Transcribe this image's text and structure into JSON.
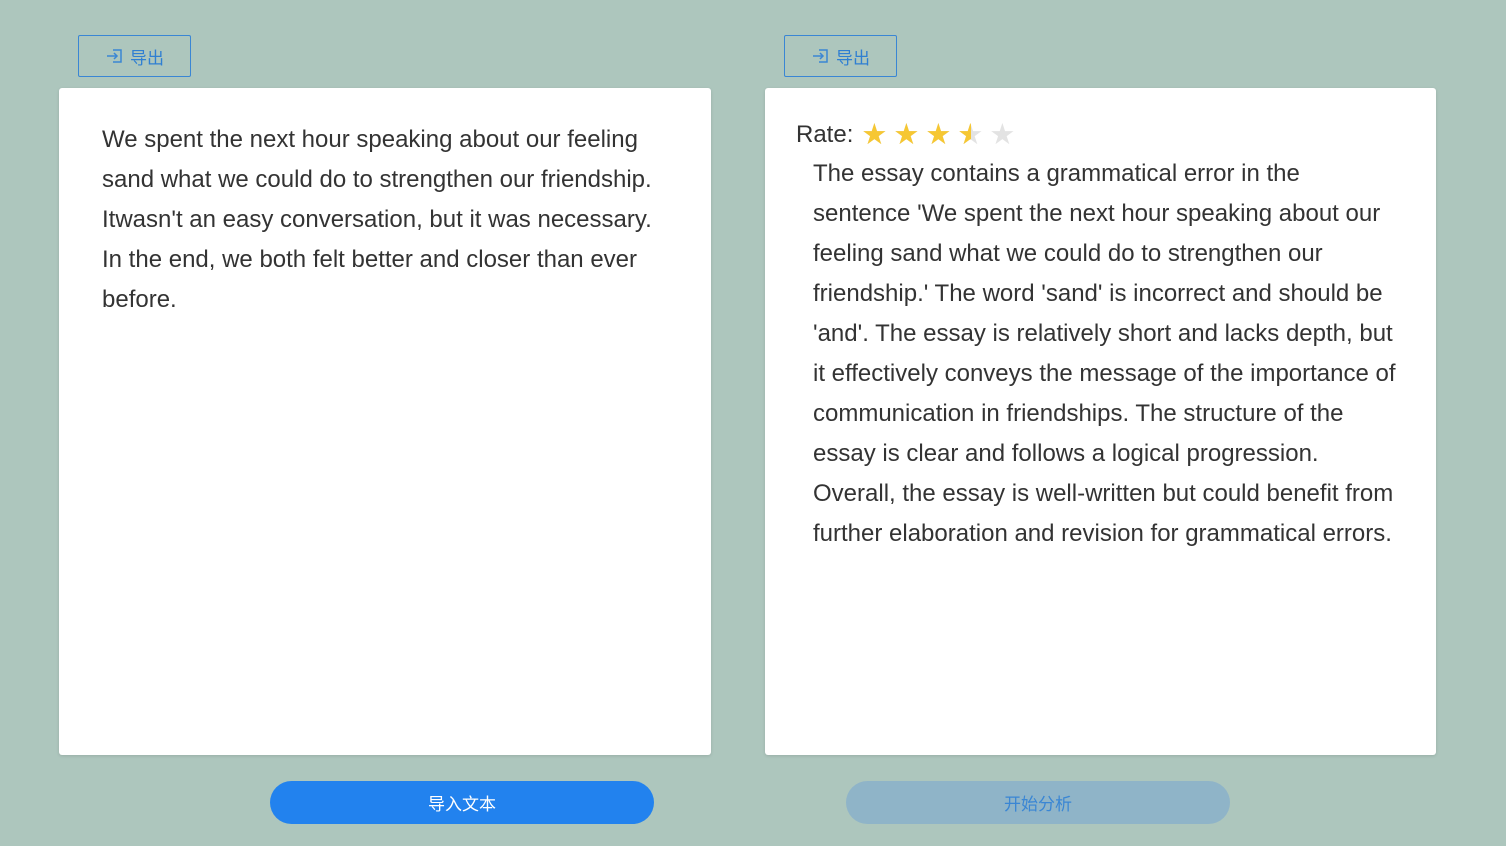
{
  "toolbar": {
    "export_left_label": "导出",
    "export_right_label": "导出"
  },
  "left_panel": {
    "essay": "We spent the next hour speaking about our feeling sand what we could do to strengthen our friendship. Itwasn't an easy conversation, but it was necessary. In the end, we both felt better and closer than ever before."
  },
  "right_panel": {
    "rate_label": "Rate:",
    "rating": 3.5,
    "rating_max": 5,
    "analysis": "The essay contains a grammatical error in the sentence 'We spent the next hour speaking about our feeling sand what we could do to strengthen our friendship.' The word 'sand' is incorrect and should be 'and'. The essay is relatively short and lacks depth, but it effectively conveys the message of the importance of communication in friendships. The structure of the essay is clear and follows a logical progression. Overall, the essay is well-written but could benefit from further elaboration and revision for grammatical errors."
  },
  "actions": {
    "import_label": "导入文本",
    "analyze_label": "开始分析",
    "analyze_disabled": true
  },
  "colors": {
    "background": "#adc6bd",
    "primary": "#2282ee",
    "disabled": "#8fb4c8",
    "star": "#f6c733"
  },
  "icons": {
    "export": "export-icon",
    "star": "star-icon"
  }
}
